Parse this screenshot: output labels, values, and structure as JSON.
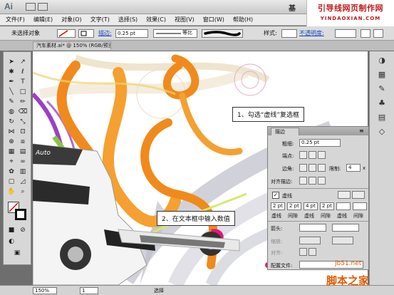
{
  "menu": [
    "文件(F)",
    "编辑(E)",
    "对象(O)",
    "文字(T)",
    "选择(S)",
    "效果(C)",
    "视图(V)",
    "窗口(W)",
    "帮助(H)"
  ],
  "title_partial": "基",
  "brand": {
    "line1": "引导线网页制作网",
    "line2": "YINDAOXIAN.COM"
  },
  "control": {
    "selection": "未选择对象",
    "stroke_label": "描边:",
    "stroke_value": "0.25 pt",
    "profile": "等比",
    "style_label": "样式:",
    "opacity_label": "不透明度:"
  },
  "doc_tab": "汽车素材.ai* @ 150% (RGB/预览)",
  "callouts": {
    "one": "1、勾选“虚线”复选框",
    "two": "2、在文本框中输入数值"
  },
  "stroke_panel": {
    "tab": "描边",
    "weight_label": "粗细:",
    "weight_value": "0.25 pt",
    "cap_label": "端点:",
    "corner_label": "边角:",
    "limit_label": "限制:",
    "limit_value": "4",
    "limit_x": "x",
    "align_label": "对齐描边:",
    "dashed_label": "虚线",
    "dash_values": [
      "2 pt",
      "2 pt",
      "4 pt",
      "2 pt",
      "",
      ""
    ],
    "dash_labels": [
      "虚线",
      "间隙",
      "虚线",
      "间隙",
      "虚线",
      "间隙"
    ],
    "arrow_label": "箭头:",
    "scale_label": "缩放:",
    "align_arrow_label": "对齐:",
    "profile_label": "配置文件:"
  },
  "status": {
    "zoom": "150%",
    "page": "1",
    "tool": "选择"
  },
  "watermarks": {
    "url": "jb51.net",
    "name": "脚本之家",
    "canvas_text": "Auto"
  },
  "colors": {
    "orange": "#f08a1c",
    "purple": "#9b3fc7",
    "green": "#8cc63f",
    "pink": "#e8157c",
    "link": "#1846c4",
    "brand": "#c21818"
  }
}
